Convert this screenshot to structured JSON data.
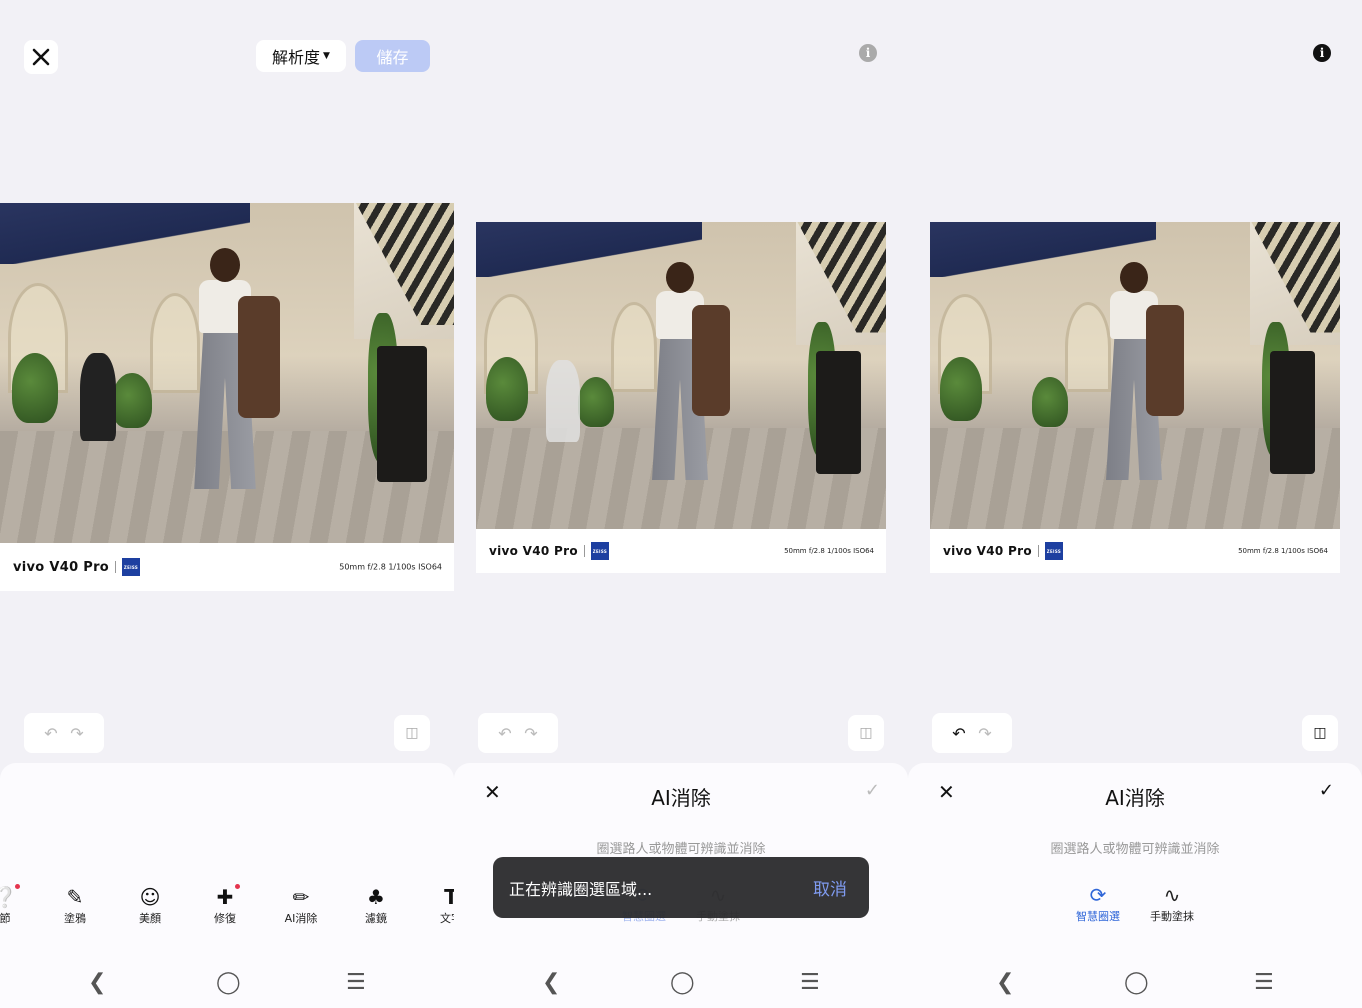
{
  "panel1": {
    "resolution_label": "解析度",
    "save_label": "儲存",
    "caption": {
      "brand": "vivo V40 Pro",
      "zeiss": "ZEISS",
      "exif": "50mm  f/2.8  1/100s  ISO64"
    },
    "tools": [
      {
        "icon": "adjust-icon",
        "label": "節"
      },
      {
        "icon": "doodle-icon",
        "label": "塗鴉"
      },
      {
        "icon": "beauty-icon",
        "label": "美顏"
      },
      {
        "icon": "repair-icon",
        "label": "修復"
      },
      {
        "icon": "ai-erase-icon",
        "label": "AI消除"
      },
      {
        "icon": "filter-icon",
        "label": "濾鏡"
      },
      {
        "icon": "text-icon",
        "label": "文字"
      }
    ]
  },
  "panel2": {
    "caption": {
      "brand": "vivo V40 Pro",
      "zeiss": "ZEISS",
      "exif": "50mm  f/2.8  1/100s  ISO64"
    },
    "sheet_title": "AI消除",
    "hint": "圈選路人或物體可辨識並消除",
    "modes": [
      {
        "label": "智慧圈選"
      },
      {
        "label": "手動塗抹"
      }
    ],
    "toast": {
      "message": "正在辨識圈選區域...",
      "cancel": "取消"
    }
  },
  "panel3": {
    "caption": {
      "brand": "vivo V40 Pro",
      "zeiss": "ZEISS",
      "exif": "50mm  f/2.8  1/100s  ISO64"
    },
    "sheet_title": "AI消除",
    "hint": "圈選路人或物體可辨識並消除",
    "modes": [
      {
        "label": "智慧圈選"
      },
      {
        "label": "手動塗抹"
      }
    ]
  },
  "colors": {
    "accent": "#2f66d8",
    "save_disabled": "#bccaf5",
    "toast_bg": "#28282a"
  }
}
